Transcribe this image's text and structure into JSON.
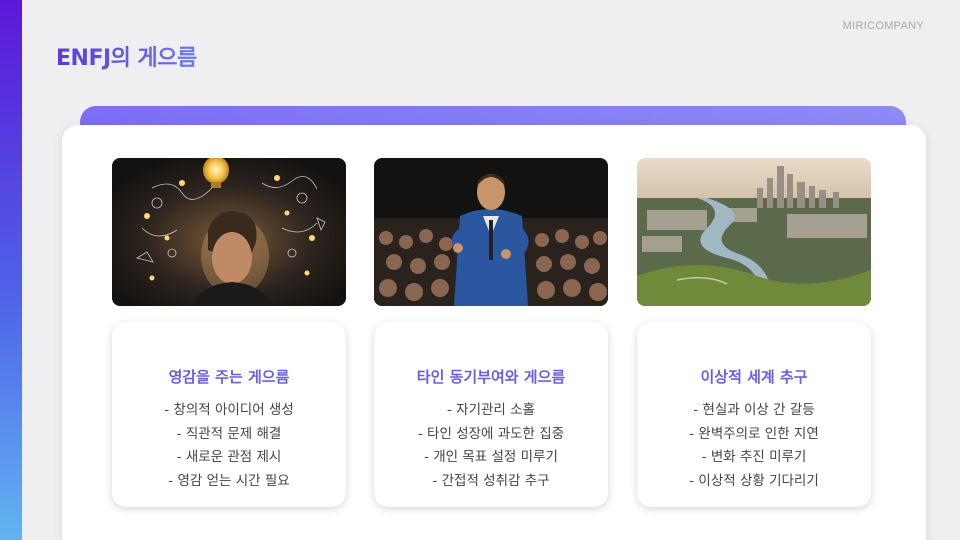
{
  "header": {
    "brand": "MIRICOMPANY",
    "title": "ENFJ의 게으름"
  },
  "colors": {
    "accent": "#7c6ef5",
    "title": "#5a3fd6",
    "card_title": "#6a5fe0",
    "side_bar_top": "#5b18d9",
    "side_bar_bottom": "#63b3f2"
  },
  "columns": [
    {
      "image": "lightbulb-ideas-portrait",
      "heading": "영감을 주는 게으름",
      "items": [
        "- 창의적 아이디어 생성",
        "- 직관적 문제 해결",
        "- 새로운 관점 제시",
        "- 영감 얻는 시간 필요"
      ]
    },
    {
      "image": "speaker-audience-photo",
      "heading": "타인 동기부여와 게으름",
      "items": [
        "- 자기관리 소홀",
        "- 타인 성장에 과도한 집중",
        "- 개인 목표 설정 미루기",
        "- 간접적 성취감 추구"
      ]
    },
    {
      "image": "city-river-landscape",
      "heading": "이상적 세계 추구",
      "items": [
        "- 현실과 이상 간 갈등",
        "- 완벽주의로 인한 지연",
        "- 변화 추진 미루기",
        "- 이상적 상황 기다리기"
      ]
    }
  ]
}
